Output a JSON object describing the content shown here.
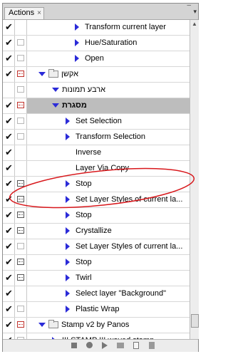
{
  "panel": {
    "tab_label": "Actions",
    "tab_close": "×"
  },
  "icons": {
    "checkmark": "✔",
    "toggle_dialog": "dialog-box",
    "expand_arrow": "triangle",
    "folder": "folder"
  },
  "rows": [
    {
      "check": true,
      "dialog": "none",
      "indent": 3,
      "arrow": "right",
      "folder": false,
      "label": "Transform current layer"
    },
    {
      "check": true,
      "dialog": "empty",
      "indent": 3,
      "arrow": "right",
      "folder": false,
      "label": "Hue/Saturation"
    },
    {
      "check": true,
      "dialog": "empty",
      "indent": 3,
      "arrow": "right",
      "folder": false,
      "label": "Open"
    },
    {
      "check": true,
      "dialog": "red",
      "indent": 0,
      "arrow": "down",
      "folder": true,
      "label": "אקשן"
    },
    {
      "check": false,
      "dialog": "empty",
      "indent": 1,
      "arrow": "down",
      "folder": false,
      "label": "ארבע תמונות"
    },
    {
      "check": true,
      "dialog": "red",
      "indent": 1,
      "arrow": "down",
      "folder": false,
      "label": "מסגרת",
      "selected": true
    },
    {
      "check": true,
      "dialog": "empty",
      "indent": 2,
      "arrow": "right",
      "folder": false,
      "label": "Set Selection"
    },
    {
      "check": true,
      "dialog": "empty",
      "indent": 2,
      "arrow": "right",
      "folder": false,
      "label": "Transform Selection"
    },
    {
      "check": true,
      "dialog": "none",
      "indent": 2,
      "arrow": "none",
      "folder": false,
      "label": "Inverse"
    },
    {
      "check": true,
      "dialog": "none",
      "indent": 2,
      "arrow": "none",
      "folder": false,
      "label": "Layer Via Copy"
    },
    {
      "check": true,
      "dialog": "dark",
      "indent": 2,
      "arrow": "right",
      "folder": false,
      "label": "Stop"
    },
    {
      "check": true,
      "dialog": "dark",
      "indent": 2,
      "arrow": "right",
      "folder": false,
      "label": "Set Layer Styles of current la..."
    },
    {
      "check": true,
      "dialog": "dark",
      "indent": 2,
      "arrow": "right",
      "folder": false,
      "label": "Stop"
    },
    {
      "check": true,
      "dialog": "dark",
      "indent": 2,
      "arrow": "right",
      "folder": false,
      "label": "Crystallize"
    },
    {
      "check": true,
      "dialog": "empty",
      "indent": 2,
      "arrow": "right",
      "folder": false,
      "label": "Set Layer Styles of current la..."
    },
    {
      "check": true,
      "dialog": "dark",
      "indent": 2,
      "arrow": "right",
      "folder": false,
      "label": "Stop"
    },
    {
      "check": true,
      "dialog": "dark",
      "indent": 2,
      "arrow": "right",
      "folder": false,
      "label": "Twirl"
    },
    {
      "check": true,
      "dialog": "none",
      "indent": 2,
      "arrow": "right",
      "folder": false,
      "label": "Select layer \"Background\""
    },
    {
      "check": true,
      "dialog": "empty",
      "indent": 2,
      "arrow": "right",
      "folder": false,
      "label": "Plastic Wrap"
    },
    {
      "check": true,
      "dialog": "red",
      "indent": 0,
      "arrow": "down",
      "folder": true,
      "label": "Stamp v2 by Panos"
    },
    {
      "check": true,
      "dialog": "empty",
      "indent": 1,
      "arrow": "right",
      "folder": false,
      "label": "!!! STAMP !!! waved stamp"
    }
  ],
  "annotation": {
    "shape": "ellipse",
    "color": "#d8171b",
    "marks_rows": [
      "Stop",
      "Set Layer Styles of current la..."
    ]
  },
  "colors": {
    "arrow": "#2b2bd8",
    "selected_row": "#bdbdbd",
    "dialog_red": "#c0302a"
  }
}
